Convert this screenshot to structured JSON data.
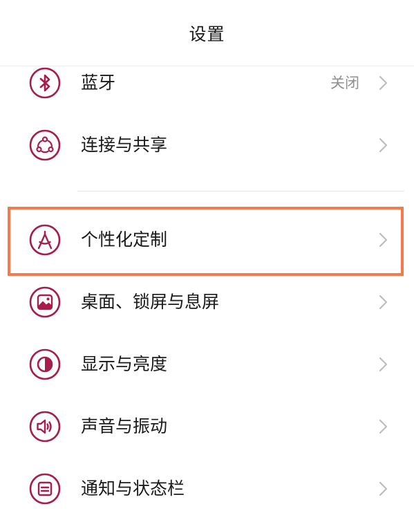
{
  "header": {
    "title": "设置"
  },
  "theme": {
    "accent": "#a81c4a",
    "highlight": "#f5794a"
  },
  "items": [
    {
      "label": "蓝牙",
      "value": "关闭",
      "icon": "bluetooth-icon"
    },
    {
      "label": "连接与共享",
      "icon": "connection-share-icon"
    },
    {
      "label": "个性化定制",
      "icon": "personalization-icon"
    },
    {
      "label": "桌面、锁屏与息屏",
      "icon": "wallpaper-icon"
    },
    {
      "label": "显示与亮度",
      "icon": "display-brightness-icon"
    },
    {
      "label": "声音与振动",
      "icon": "sound-vibration-icon"
    },
    {
      "label": "通知与状态栏",
      "icon": "notification-statusbar-icon"
    }
  ]
}
